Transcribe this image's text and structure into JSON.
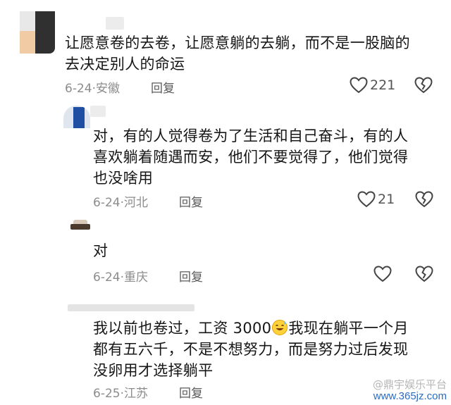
{
  "comments": [
    {
      "text_lines": [
        "让愿意卷的去卷，让愿意躺的去躺，而不是一股脑的",
        "去决定别人的命运"
      ],
      "date": "6-24",
      "location": "安徽",
      "reply_label": "回复",
      "likes": "221"
    },
    {
      "text_lines": [
        "对，有的人觉得卷为了生活和自己奋斗，有的人",
        "喜欢躺着随遇而安，他们不要觉得了，他们觉得",
        "也没啥用"
      ],
      "date": "6-24",
      "location": "河北",
      "reply_label": "回复",
      "likes": "21"
    },
    {
      "text_lines": [
        "对"
      ],
      "date": "6-24",
      "location": "重庆",
      "reply_label": "回复",
      "likes": ""
    },
    {
      "text_part1": "我以前也卷过，工资 3000",
      "text_part2": "我现在躺平一个月",
      "text_lines": [
        "都有五六千，不是不想努力，而是努力过后发现",
        "没卵用才选择躺平"
      ],
      "date": "6-25",
      "location": "江苏",
      "reply_label": "回复",
      "likes": ""
    }
  ],
  "separator": "·",
  "watermark": {
    "line1": "@鼎宇娱乐平台",
    "line2": "www.365jz.com"
  },
  "icons": {
    "like": "heart-outline-icon",
    "dislike": "broken-heart-icon",
    "emoji": "sweat-smile-emoji-icon"
  },
  "colors": {
    "text": "#161616",
    "meta": "#8c8c8c",
    "watermark_url": "#2b6cc4"
  }
}
